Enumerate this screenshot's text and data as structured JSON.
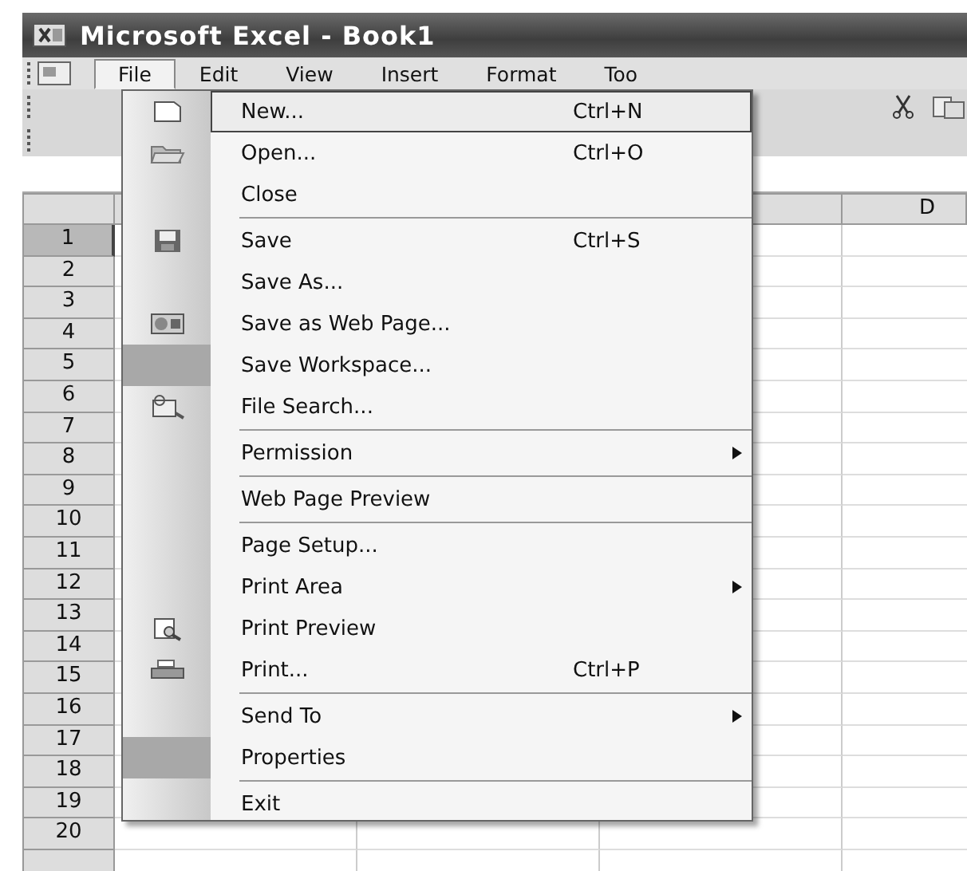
{
  "window": {
    "title": "Microsoft Excel - Book1"
  },
  "menu_bar": [
    {
      "label": "File",
      "selected": true
    },
    {
      "label": "Edit",
      "selected": false
    },
    {
      "label": "View",
      "selected": false
    },
    {
      "label": "Insert",
      "selected": false
    },
    {
      "label": "Format",
      "selected": false
    },
    {
      "label": "Too",
      "selected": false
    }
  ],
  "sheet": {
    "column_headers": [
      "D"
    ],
    "row_headers": [
      {
        "label": "1",
        "selected": true
      },
      {
        "label": "2",
        "selected": false
      },
      {
        "label": "3",
        "selected": false
      },
      {
        "label": "4",
        "selected": false
      },
      {
        "label": "5",
        "selected": false
      },
      {
        "label": "6",
        "selected": false
      },
      {
        "label": "7",
        "selected": false
      },
      {
        "label": "8",
        "selected": false
      },
      {
        "label": "9",
        "selected": false
      },
      {
        "label": "10",
        "selected": false
      },
      {
        "label": "11",
        "selected": false
      },
      {
        "label": "12",
        "selected": false
      },
      {
        "label": "13",
        "selected": false
      },
      {
        "label": "14",
        "selected": false
      },
      {
        "label": "15",
        "selected": false
      },
      {
        "label": "16",
        "selected": false
      },
      {
        "label": "17",
        "selected": false
      },
      {
        "label": "18",
        "selected": false
      },
      {
        "label": "19",
        "selected": false
      },
      {
        "label": "20",
        "selected": false
      }
    ]
  },
  "file_menu": [
    {
      "kind": "item",
      "label": "New...",
      "shortcut": "Ctrl+N",
      "selected": true
    },
    {
      "kind": "item",
      "label": "Open...",
      "shortcut": "Ctrl+O",
      "selected": false
    },
    {
      "kind": "item",
      "label": "Close",
      "selected": false
    },
    {
      "kind": "separator"
    },
    {
      "kind": "item",
      "label": "Save",
      "shortcut": "Ctrl+S",
      "selected": false
    },
    {
      "kind": "item",
      "label": "Save As...",
      "selected": false
    },
    {
      "kind": "item",
      "label": "Save as Web Page...",
      "selected": false
    },
    {
      "kind": "item",
      "label": "Save Workspace...",
      "selected": false
    },
    {
      "kind": "item",
      "label": "File Search...",
      "selected": false
    },
    {
      "kind": "separator"
    },
    {
      "kind": "item",
      "label": "Permission",
      "submenu": true,
      "selected": false
    },
    {
      "kind": "separator"
    },
    {
      "kind": "item",
      "label": "Web Page Preview",
      "selected": false
    },
    {
      "kind": "separator"
    },
    {
      "kind": "item",
      "label": "Page Setup...",
      "selected": false
    },
    {
      "kind": "item",
      "label": "Print Area",
      "submenu": true,
      "selected": false
    },
    {
      "kind": "item",
      "label": "Print Preview",
      "selected": false
    },
    {
      "kind": "item",
      "label": "Print...",
      "shortcut": "Ctrl+P",
      "selected": false
    },
    {
      "kind": "separator"
    },
    {
      "kind": "item",
      "label": "Send To",
      "submenu": true,
      "selected": false
    },
    {
      "kind": "item",
      "label": "Properties",
      "selected": false
    },
    {
      "kind": "separator"
    },
    {
      "kind": "item",
      "label": "Exit",
      "selected": false
    }
  ]
}
